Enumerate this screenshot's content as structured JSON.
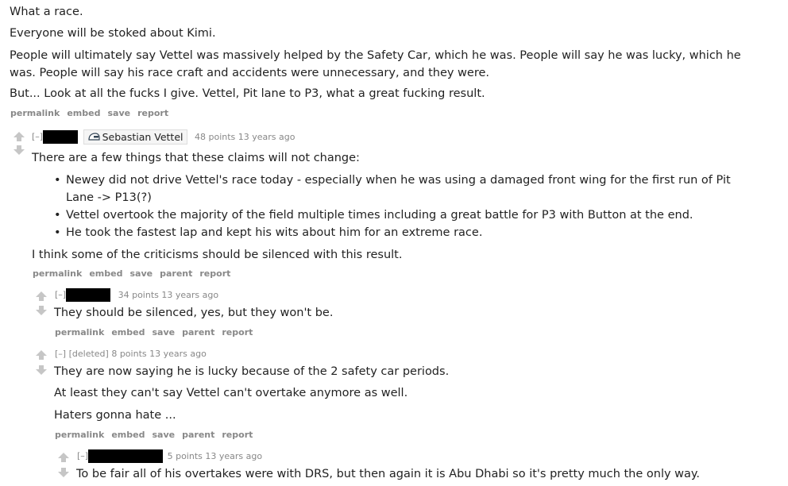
{
  "top_comment": {
    "paragraphs": [
      "What a race.",
      "Everyone will be stoked about Kimi.",
      "People will ultimately say Vettel was massively helped by the Safety Car, which he was. People will say he was lucky, which he was. People will say his race craft and accidents were unnecessary, and they were.",
      "But... Look at all the fucks I give. Vettel, Pit lane to P3, what a great fucking result."
    ],
    "links": [
      "permalink",
      "embed",
      "save",
      "report"
    ]
  },
  "reply1": {
    "toggle": "[–]",
    "flair_text": "Sebastian Vettel",
    "points": "48 points 13 years ago",
    "intro": "There are a few things that these claims will not change:",
    "bullets": [
      "Newey did not drive Vettel's race today - especially when he was using a damaged front wing for the first run of Pit Lane -> P13(?)",
      "Vettel overtook the majority of the field multiple times including a great battle for P3 with Button at the end.",
      "He took the fastest lap and kept his wits about him for an extreme race."
    ],
    "outro": "I think some of the criticisms should be silenced with this result.",
    "links": [
      "permalink",
      "embed",
      "save",
      "parent",
      "report"
    ]
  },
  "reply2": {
    "toggle": "[–]",
    "points": "34 points 13 years ago",
    "text": "They should be silenced, yes, but they won't be.",
    "links": [
      "permalink",
      "embed",
      "save",
      "parent",
      "report"
    ]
  },
  "reply3": {
    "toggle": "[–]",
    "author": "[deleted]",
    "points": "8 points 13 years ago",
    "paragraphs": [
      "They are now saying he is lucky because of the 2 safety car periods.",
      "At least they can't say Vettel can't overtake anymore as well.",
      "Haters gonna hate ..."
    ],
    "links": [
      "permalink",
      "embed",
      "save",
      "parent",
      "report"
    ]
  },
  "reply4": {
    "toggle": "[–]",
    "points": "5 points 13 years ago",
    "text": "To be fair all of his overtakes were with DRS, but then again it is Abu Dhabi so it's pretty much the only way."
  },
  "colors": {
    "text": "#222222",
    "muted": "#888888",
    "arrow": "#c6c6c6",
    "redaction": "#000000"
  }
}
